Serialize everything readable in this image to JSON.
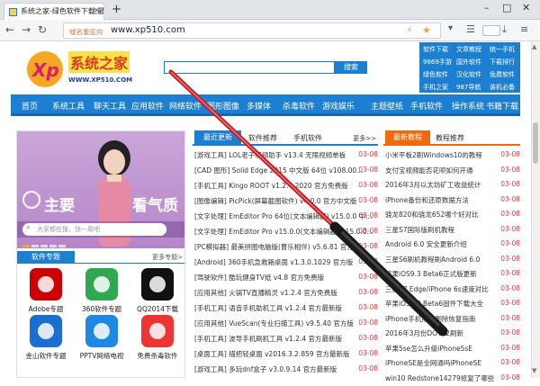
{
  "browser": {
    "tab_title": "系统之家-绿色软件下载,最新",
    "tab_close": "×",
    "new_tab": "+",
    "address_hint": "域名重定向",
    "url": "www.xp510.com",
    "colors": {
      "accent": "#1c7fd1",
      "orange": "#f06a0a",
      "date_red": "#e4393c"
    }
  },
  "site": {
    "logo_text": "系统之家",
    "logo_url": "WWW.XP510.COM",
    "search_button": "搜索",
    "top_links": [
      "软件下载",
      "文章教程",
      "统一手机",
      "9669手游",
      "国外软件",
      "下载排行",
      "绿色软件",
      "汉化软件",
      "免费软件",
      "手机之家",
      "987导航",
      "装机必备"
    ],
    "nav": [
      "首页",
      "系统工具",
      "聊天工具",
      "应用软件",
      "网络软件",
      "图形图像",
      "多媒体",
      "杀毒软件",
      "游戏娱乐",
      "主题壁纸",
      "手机软件",
      "操作系统",
      "书籍下载"
    ]
  },
  "left": {
    "banner_text_1": "主要",
    "banner_text_2": "看气质",
    "search_placeholder": "大家都在搜，快一周吧",
    "tab_active": "软件专题",
    "more": "更多专题>",
    "apps": [
      {
        "label": "Adobe专题",
        "icon": "adobe-icon"
      },
      {
        "label": "360软件专题",
        "icon": "360-icon"
      },
      {
        "label": "QQ2014下载",
        "icon": "qq-icon"
      },
      {
        "label": "金山软件专题",
        "icon": "kingsoft-icon"
      },
      {
        "label": "PPTV网络电视",
        "icon": "pptv-icon"
      },
      {
        "label": "免费杀毒软件",
        "icon": "antivirus-icon"
      }
    ]
  },
  "middle": {
    "tabs": [
      "最近更新",
      "软件推荐",
      "手机软件"
    ],
    "more": "更多>>",
    "rows": [
      {
        "title": "[游戏工具] LOL老子视频助手 v13.4 无限视频单板",
        "date": "03-08"
      },
      {
        "title": "[CAD 图形] Solid Edge 2015 中文版 64位 v108.00...",
        "date": "03-08"
      },
      {
        "title": "[手机工具] Kingo ROOT v1.2.4 2020 官方免费版",
        "date": "03-08"
      },
      {
        "title": "[图像编辑] PicPick(屏幕截图软件) v4.0.0 官方中文版",
        "date": "03-08"
      },
      {
        "title": "[文字处理] EmEditor Pro 64位(文本编辑器) v15.0.0 中...",
        "date": "03-08"
      },
      {
        "title": "[文字处理] EmEditor Pro v15.0.0(文本编辑器) v15.0.0...",
        "date": "03-08"
      },
      {
        "title": "[PC模拟器] 最美拼图电脑版(曹乐相伴) v5.6.81 官方版",
        "date": "03-08"
      },
      {
        "title": "[Android] 360手机急救箱桌面 v1.3.0.1029 官方版",
        "date": "03-08"
      },
      {
        "title": "[驾驶软件] 酷玩健身TV纸 v4.8 官方免费版",
        "date": "03-08"
      },
      {
        "title": "[应用其他] 火锅TV直播精灵 v1.2.4 官方免费版",
        "date": "03-08"
      },
      {
        "title": "[手机工具] 语音手机助机工具 v1.2.4 官方最新版",
        "date": "03-08"
      },
      {
        "title": "[应用其他] VueScan(专业扫描工具) v9.5.40 官方版",
        "date": "03-08"
      },
      {
        "title": "[手机工具] 波导手机刷机工具 v1.2.4 官方最新版",
        "date": "03-08"
      },
      {
        "title": "[桌面工具] 描把轻桌面 v2016.3.2.859 官方最新版",
        "date": "03-08"
      },
      {
        "title": "[游戏工具] 多玩dnf盒子 v3.0.9.14 官方最新版",
        "date": "03-08"
      }
    ]
  },
  "right": {
    "tabs": [
      "最新教程",
      "教程推荐"
    ],
    "rows": [
      {
        "title": "小米平板2刷Windows10的教程",
        "date": "03-08"
      },
      {
        "title": "支付宝视频能否花呗如何开通",
        "date": "03-08"
      },
      {
        "title": "2016年3月以太坊矿工收益统计",
        "date": "03-08"
      },
      {
        "title": "iPhone备份和还原数据方法",
        "date": "03-08"
      },
      {
        "title": "骁龙820和骁龙652哪个好对比",
        "date": "03-08"
      },
      {
        "title": "三星S7国际版刷机教程",
        "date": "03-08"
      },
      {
        "title": "Android 6.0 安全更新介绍",
        "date": "03-08"
      },
      {
        "title": "三星S6刷机教程刷Android 6.0",
        "date": "03-08"
      },
      {
        "title": "苹果iOS9.3 Beta6正式版更新",
        "date": "03-08"
      },
      {
        "title": "三星S7 Edge/iPhone 6s速度对比",
        "date": "03-08"
      },
      {
        "title": "苹果iOS9.3 Beta6固件下载大全",
        "date": "03-08"
      },
      {
        "title": "iPhone手机照片删除恢复指南",
        "date": "03-08"
      },
      {
        "title": "2016年3月份DOTA2刷新",
        "date": "03-08"
      },
      {
        "title": "苹果5se怎么升级iPhone5sE",
        "date": "03-08"
      },
      {
        "title": "iPhoneSE是全网通吗iPhoneSE",
        "date": "03-08"
      },
      {
        "title": "win10 Redstone14279修复了哪些",
        "date": "03-08"
      }
    ]
  }
}
